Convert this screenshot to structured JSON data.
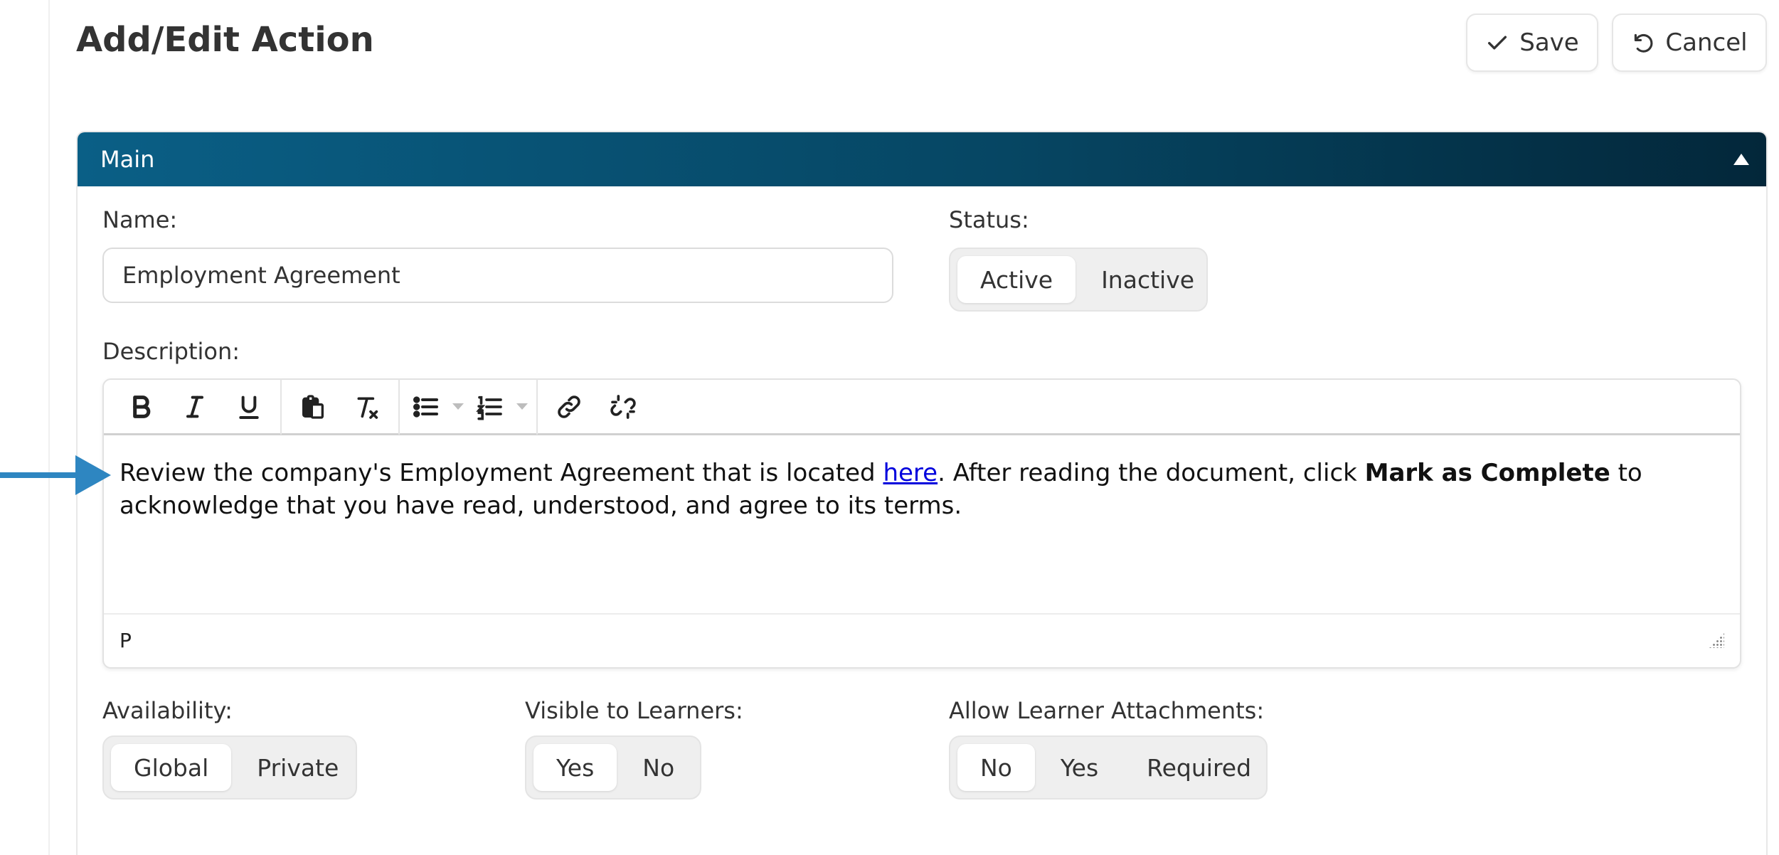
{
  "page": {
    "title": "Add/Edit Action"
  },
  "header": {
    "save_label": "Save",
    "cancel_label": "Cancel"
  },
  "panel": {
    "title": "Main"
  },
  "form": {
    "name": {
      "label": "Name:",
      "value": "Employment Agreement"
    },
    "status": {
      "label": "Status:",
      "options": [
        "Active",
        "Inactive"
      ],
      "selected": "Active"
    },
    "description": {
      "label": "Description:",
      "content": {
        "part1": "Review the company's Employment Agreement that is located ",
        "link_text": "here",
        "part2": ". After reading the document, click ",
        "bold_text": "Mark as Complete",
        "part3": " to acknowledge that you have read, understood, and agree to its terms."
      },
      "status_path": "P",
      "toolbar_icons": [
        "bold-icon",
        "italic-icon",
        "underline-icon",
        "paste-icon",
        "clear-formatting-icon",
        "bullet-list-icon",
        "numbered-list-icon",
        "link-icon",
        "unlink-icon"
      ]
    },
    "availability": {
      "label": "Availability:",
      "options": [
        "Global",
        "Private"
      ],
      "selected": "Global"
    },
    "visible_to_learners": {
      "label": "Visible to Learners:",
      "options": [
        "Yes",
        "No"
      ],
      "selected": "Yes"
    },
    "allow_learner_attachments": {
      "label": "Allow Learner Attachments:",
      "options": [
        "No",
        "Yes",
        "Required"
      ],
      "selected": "No"
    }
  },
  "colors": {
    "header_gradient_start": "#0a5f86",
    "header_gradient_end": "#03273a",
    "arrow": "#2e86c1",
    "link": "#0000dd"
  }
}
